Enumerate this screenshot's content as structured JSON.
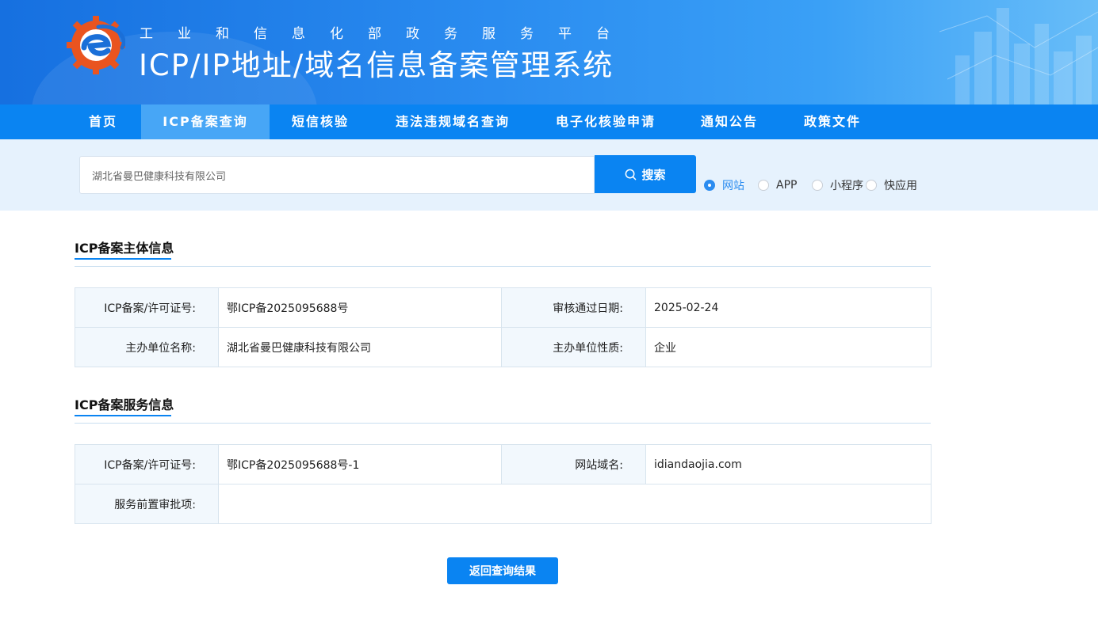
{
  "header": {
    "subtitle": "工业和信息化部政务服务平台",
    "title": "ICP/IP地址/域名信息备案管理系统",
    "logo_icon": "ministry-gear-e-logo-icon"
  },
  "nav": {
    "items": [
      {
        "label": "首页",
        "active": false
      },
      {
        "label": "ICP备案查询",
        "active": true
      },
      {
        "label": "短信核验",
        "active": false
      },
      {
        "label": "违法违规域名查询",
        "active": false
      },
      {
        "label": "电子化核验申请",
        "active": false
      },
      {
        "label": "通知公告",
        "active": false
      },
      {
        "label": "政策文件",
        "active": false
      }
    ]
  },
  "search": {
    "value": "湖北省曼巴健康科技有限公司",
    "button_label": "搜索",
    "search_icon": "search-icon",
    "types": [
      {
        "label": "网站",
        "checked": true
      },
      {
        "label": "APP",
        "checked": false
      },
      {
        "label": "小程序",
        "checked": false
      },
      {
        "label": "快应用",
        "checked": false
      }
    ]
  },
  "subject_info": {
    "title": "ICP备案主体信息",
    "rows": [
      {
        "k1": "ICP备案/许可证号:",
        "v1": "鄂ICP备2025095688号",
        "k2": "审核通过日期:",
        "v2": "2025-02-24"
      },
      {
        "k1": "主办单位名称:",
        "v1": "湖北省曼巴健康科技有限公司",
        "k2": "主办单位性质:",
        "v2": "企业"
      }
    ]
  },
  "service_info": {
    "title": "ICP备案服务信息",
    "rows": [
      {
        "k1": "ICP备案/许可证号:",
        "v1": "鄂ICP备2025095688号-1",
        "k2": "网站域名:",
        "v2": "idiandaojia.com"
      },
      {
        "k1": "服务前置审批项:",
        "v1": ""
      }
    ]
  },
  "actions": {
    "back_label": "返回查询结果"
  },
  "colors": {
    "primary": "#0a84f2",
    "nav_active": "#47a6f6",
    "search_band": "#e6f2fd",
    "key_cell": "#f2f8fd"
  }
}
